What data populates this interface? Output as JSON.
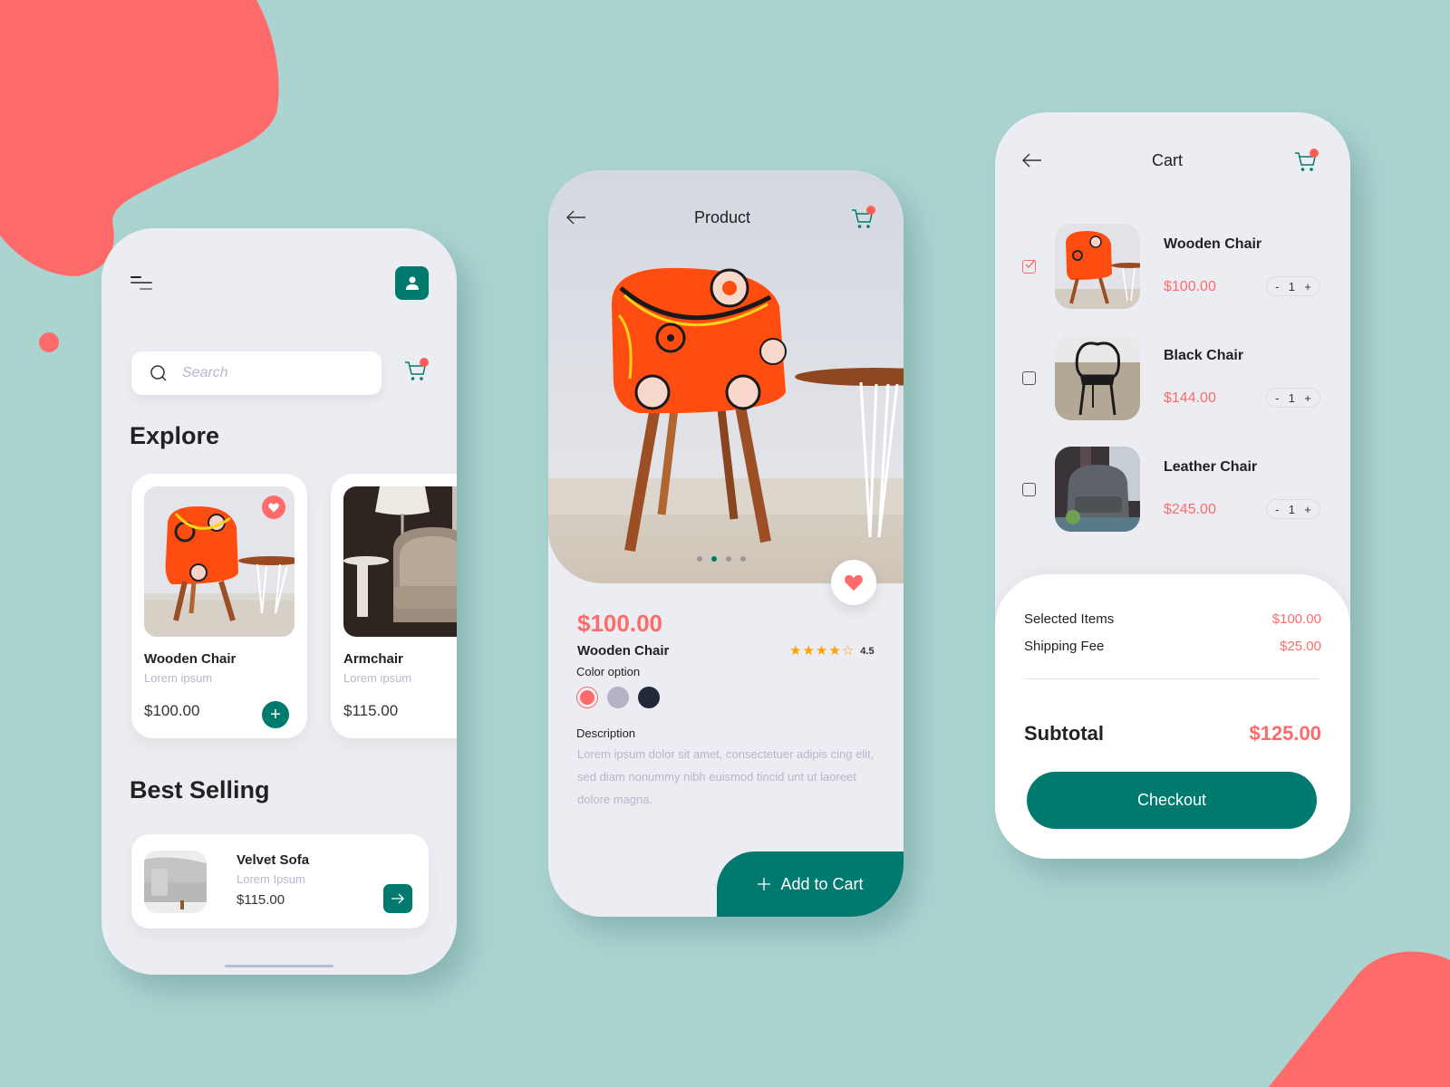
{
  "colors": {
    "background": "#abd4d1",
    "accent_coral": "#ff6b6b",
    "primary_teal": "#007a6e",
    "surface": "#ecedf2",
    "muted_text": "#b8b6cc",
    "star": "#ff9f00"
  },
  "explore_screen": {
    "menu_icon": "hamburger-menu-icon",
    "profile_icon": "user-icon",
    "search": {
      "placeholder": "Search",
      "value": "",
      "icon": "search-icon"
    },
    "cart_icon": "shopping-cart-icon",
    "cart_has_notification": true,
    "explore_title": "Explore",
    "products": [
      {
        "name": "Wooden Chair",
        "subtitle": "Lorem ipsum",
        "price": "$100.00",
        "favorited": true,
        "add_label": "+"
      },
      {
        "name": "Armchair",
        "subtitle": "Lorem ipsum",
        "price": "$115.00",
        "favorited": false
      }
    ],
    "best_selling_title": "Best Selling",
    "best_selling": [
      {
        "name": "Velvet Sofa",
        "subtitle": "Lorem Ipsum",
        "price": "$115.00",
        "action_icon": "arrow-right-icon"
      }
    ]
  },
  "product_screen": {
    "title": "Product",
    "back_icon": "arrow-left-icon",
    "cart_icon": "shopping-cart-icon",
    "carousel": {
      "total": 4,
      "active_index": 1
    },
    "favorited": true,
    "price": "$100.00",
    "name": "Wooden Chair",
    "rating": {
      "value": 4.5,
      "display": "4.5",
      "filled_stars": 4,
      "total_stars": 5
    },
    "color_option_label": "Color option",
    "color_options": [
      {
        "color": "#ff6b6b",
        "selected": true
      },
      {
        "color": "#b5b3c8",
        "selected": false
      },
      {
        "color": "#22273a",
        "selected": false
      }
    ],
    "description_label": "Description",
    "description": "Lorem ipsum dolor sit amet, consectetuer adipis cing elit, sed diam nonummy nibh euismod tincid unt ut laoreet dolore magna.",
    "add_to_cart_label": "Add to Cart"
  },
  "cart_screen": {
    "title": "Cart",
    "back_icon": "arrow-left-icon",
    "cart_icon": "shopping-cart-icon",
    "items": [
      {
        "name": "Wooden Chair",
        "price": "$100.00",
        "quantity": "1",
        "checked": true
      },
      {
        "name": "Black Chair",
        "price": "$144.00",
        "quantity": "1",
        "checked": false
      },
      {
        "name": "Leather Chair",
        "price": "$245.00",
        "quantity": "1",
        "checked": false
      }
    ],
    "stepper": {
      "minus": "-",
      "plus": "+"
    },
    "summary": {
      "selected_items_label": "Selected Items",
      "selected_items_value": "$100.00",
      "shipping_fee_label": "Shipping Fee",
      "shipping_fee_value": "$25.00",
      "subtotal_label": "Subtotal",
      "subtotal_value": "$125.00"
    },
    "checkout_label": "Checkout"
  }
}
